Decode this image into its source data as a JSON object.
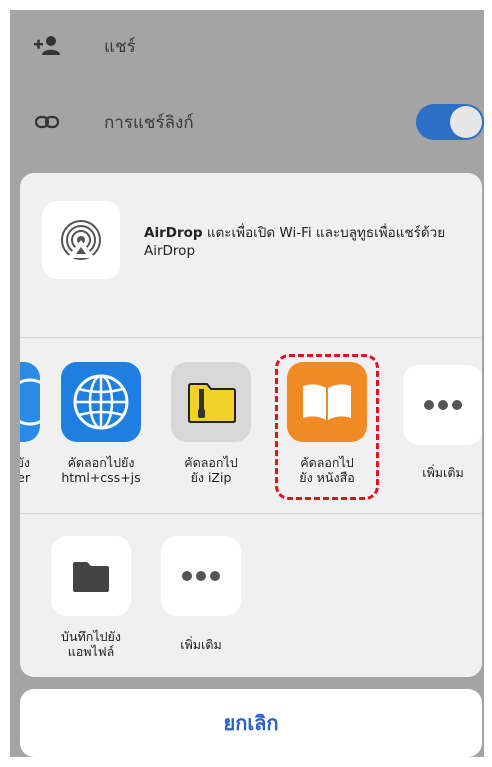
{
  "background_menu": {
    "share_label": "แชร์",
    "link_share_label": "การแชร์ลิงก์",
    "link_share_enabled": true
  },
  "airdrop": {
    "title": "AirDrop",
    "message": " แตะเพื่อเปิด Wi-Fi และบลูทูธเพื่อแชร์ด้วย AirDrop"
  },
  "apps_row": [
    {
      "label_l1": "ยัง",
      "label_l2": "er",
      "icon": "partial-app-icon"
    },
    {
      "label_l1": "คัดลอกไปยัง",
      "label_l2": "html+css+js",
      "icon": "globe-icon"
    },
    {
      "label_l1": "คัดลอกไป",
      "label_l2": "ยัง iZip",
      "icon": "zip-folder-icon"
    },
    {
      "label_l1": "คัดลอกไป",
      "label_l2": "ยัง หนังสือ",
      "icon": "books-icon"
    },
    {
      "label_l1": "เพิ่มเติม",
      "label_l2": "",
      "icon": "more-icon"
    }
  ],
  "actions_row": [
    {
      "label_l1": "บันทึกไปยัง",
      "label_l2": "แอพไฟล์",
      "icon": "folder-icon"
    },
    {
      "label_l1": "เพิ่มเติม",
      "label_l2": "",
      "icon": "more-icon"
    }
  ],
  "cancel_label": "ยกเลิก",
  "colors": {
    "accent": "#2d6fc6",
    "highlight": "#e3111b",
    "books": "#f08a24",
    "izip": "#f2d22a"
  }
}
